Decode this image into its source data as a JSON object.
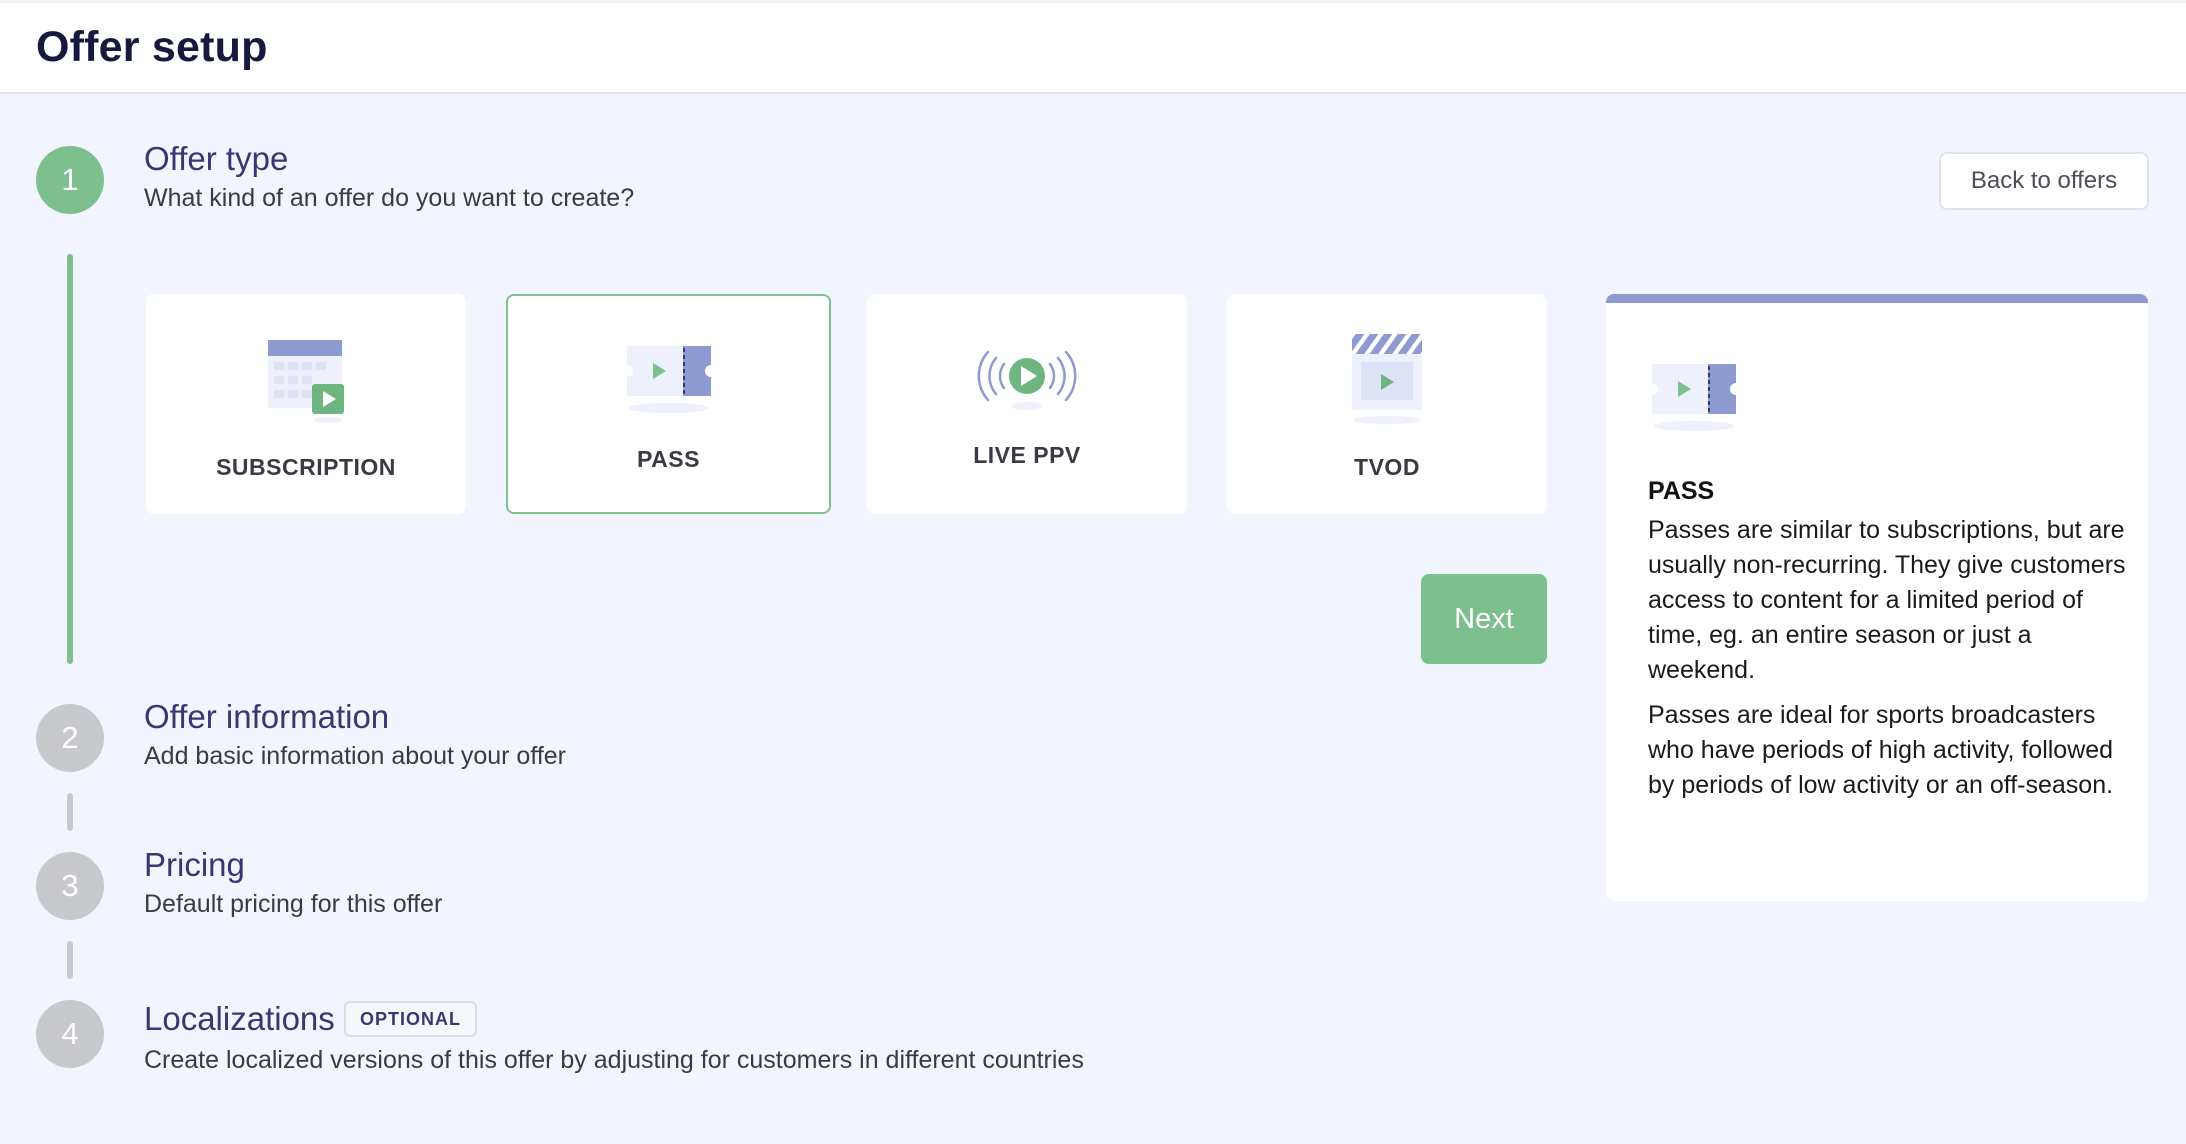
{
  "header": {
    "title": "Offer setup"
  },
  "steps": [
    {
      "number": "1",
      "title": "Offer type",
      "description": "What kind of an offer do you want to create?"
    },
    {
      "number": "2",
      "title": "Offer information",
      "description": "Add basic information about your offer"
    },
    {
      "number": "3",
      "title": "Pricing",
      "description": "Default pricing for this offer"
    },
    {
      "number": "4",
      "title": "Localizations",
      "description": "Create localized versions of this offer by adjusting for customers in different countries",
      "badge": "OPTIONAL"
    }
  ],
  "back_button": {
    "label": "Back to offers"
  },
  "offer_types": [
    {
      "label": "SUBSCRIPTION",
      "icon": "calendar-play-icon"
    },
    {
      "label": "PASS",
      "icon": "ticket-icon",
      "selected": true
    },
    {
      "label": "LIVE PPV",
      "icon": "live-broadcast-icon"
    },
    {
      "label": "TVOD",
      "icon": "clapperboard-icon"
    }
  ],
  "next_button": {
    "label": "Next"
  },
  "info_panel": {
    "icon": "ticket-icon",
    "title": "PASS",
    "paragraphs": [
      "Passes are similar to subscriptions, but are usually non-recurring. They give customers access to content for a limited period of time, eg. an entire season or just a weekend.",
      "Passes are ideal for sports broadcasters who have periods of high activity, followed by periods of low activity or an off-season."
    ]
  },
  "colors": {
    "accent_green": "#7ebf8e",
    "accent_blue": "#8e9bd0",
    "inactive": "#c8c9cc",
    "heading": "#3b3672"
  }
}
